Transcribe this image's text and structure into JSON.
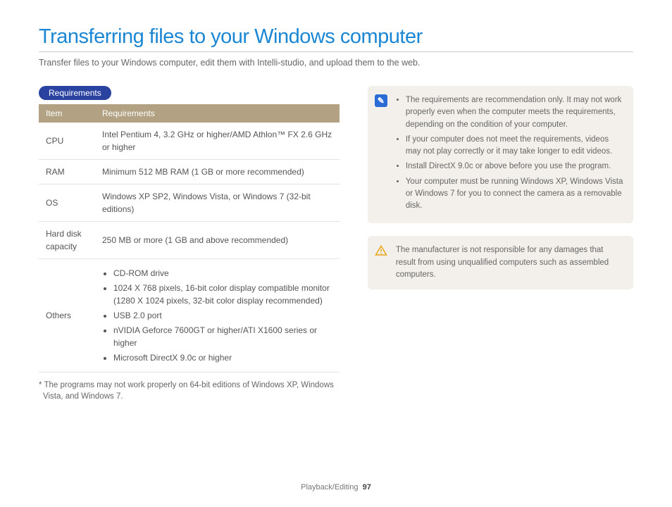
{
  "title": "Transferring files to your Windows computer",
  "intro": "Transfer files to your Windows computer, edit them with Intelli-studio, and upload them to the web.",
  "sectionBadge": "Requirements",
  "table": {
    "headers": [
      "Item",
      "Requirements"
    ],
    "rows": [
      {
        "item": "CPU",
        "req": "Intel Pentium 4, 3.2 GHz or higher/AMD Athlon™ FX 2.6 GHz or higher"
      },
      {
        "item": "RAM",
        "req": "Minimum 512 MB RAM (1 GB or more recommended)"
      },
      {
        "item": "OS",
        "req": "Windows XP SP2, Windows Vista, or Windows 7 (32-bit editions)"
      },
      {
        "item": "Hard disk capacity",
        "req": "250 MB or more (1 GB and above recommended)"
      }
    ],
    "othersLabel": "Others",
    "others": [
      "CD-ROM drive",
      "1024 X 768 pixels, 16-bit color display compatible monitor (1280 X 1024 pixels, 32-bit color display recommended)",
      "USB 2.0 port",
      "nVIDIA Geforce 7600GT or higher/ATI X1600 series or higher",
      "Microsoft DirectX 9.0c or higher"
    ]
  },
  "footnote": "* The programs may not work properly on 64-bit editions of Windows XP, Windows Vista, and Windows 7.",
  "infoNotes": [
    "The requirements are recommendation only. It may not work properly even when the computer meets the requirements, depending on the condition of your computer.",
    "If your computer does not meet the requirements, videos may not play correctly or it may take longer to edit videos.",
    "Install DirectX 9.0c or above before you use the program.",
    "Your computer must be running Windows XP, Windows Vista or Windows 7 for you to connect the camera as a removable disk."
  ],
  "warning": "The manufacturer is not responsible for any damages that result from using unqualified computers such as assembled computers.",
  "footer": {
    "section": "Playback/Editing",
    "page": "97"
  }
}
